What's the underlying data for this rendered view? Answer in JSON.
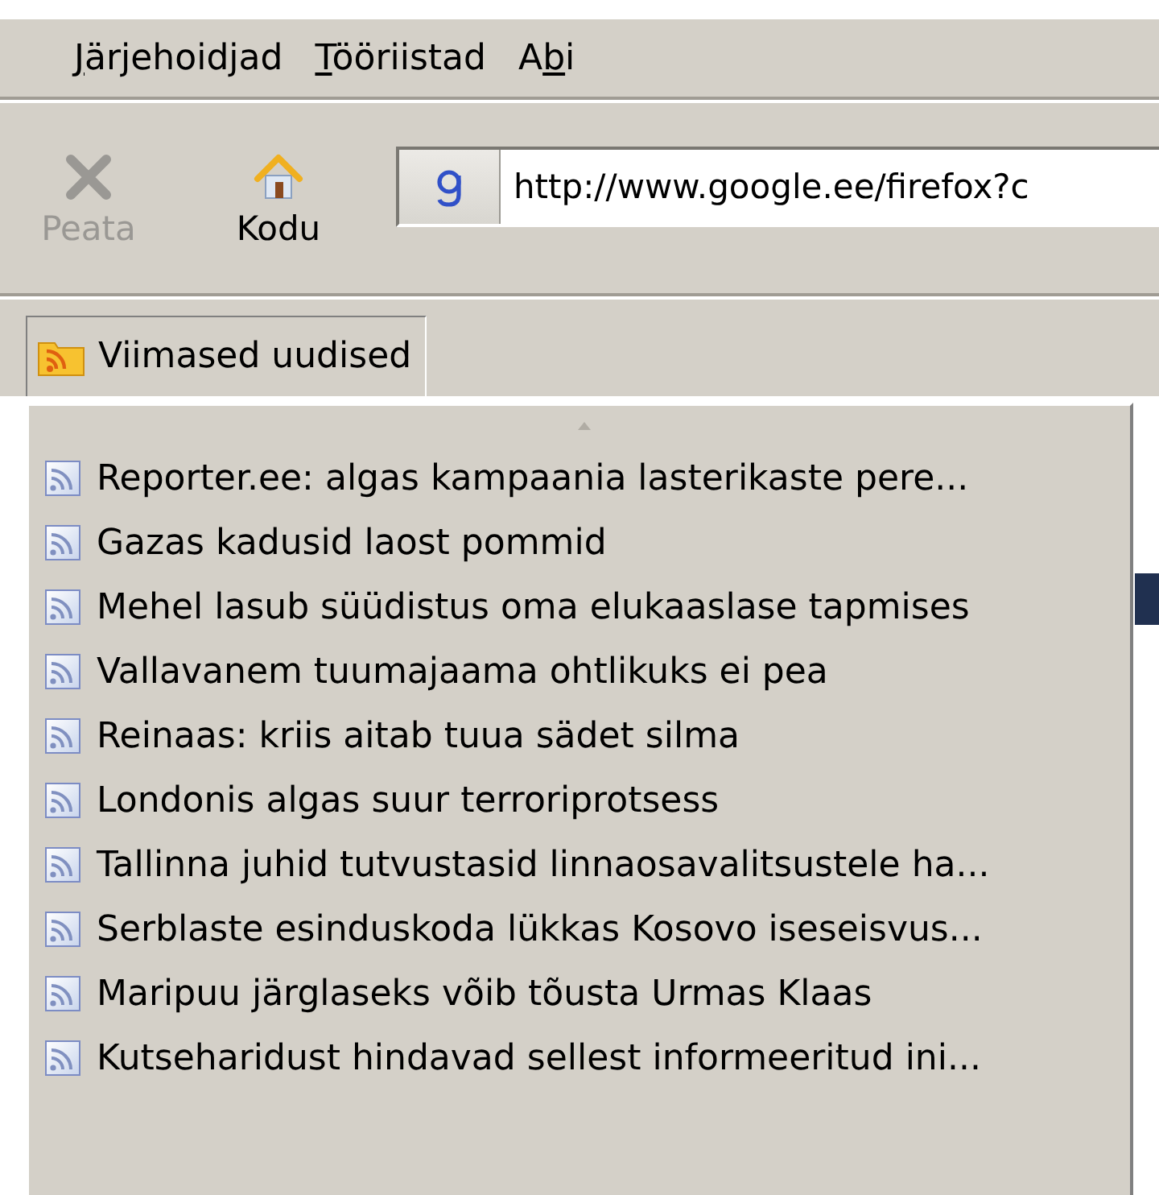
{
  "menu_bar": [
    {
      "key": "J",
      "post": "ärjehoidjad"
    },
    {
      "key": "T",
      "post": "ööriistad"
    },
    {
      "pre": "A",
      "key": "b",
      "post": "i"
    }
  ],
  "toolbar": {
    "buttons": [
      {
        "kind": "stop",
        "label": "Peata",
        "disabled": true
      },
      {
        "kind": "home",
        "label": "Kodu",
        "disabled": false
      }
    ],
    "address": {
      "value": "http://www.google.ee/firefox?c"
    }
  },
  "bookmarks_bar": [
    {
      "label": "Viimased uudised",
      "expanded": true
    }
  ],
  "feed_menu": {
    "items": [
      "Reporter.ee: algas kampaania lasterikaste pere...",
      "Gazas kadusid laost pommid",
      "Mehel lasub süüdistus oma elukaaslase tapmises",
      "Vallavanem tuumajaama ohtlikuks ei pea",
      "Reinaas: kriis aitab tuua sädet silma",
      "Londonis algas suur terroriprotsess",
      "Tallinna juhid tutvustasid linnaosavalitsustele ha...",
      "Serblaste esinduskoda lükkas Kosovo iseseisvus...",
      "Maripuu järglaseks võib tõusta Urmas Klaas",
      "Kutseharidust hindavad sellest informeeritud ini..."
    ]
  }
}
